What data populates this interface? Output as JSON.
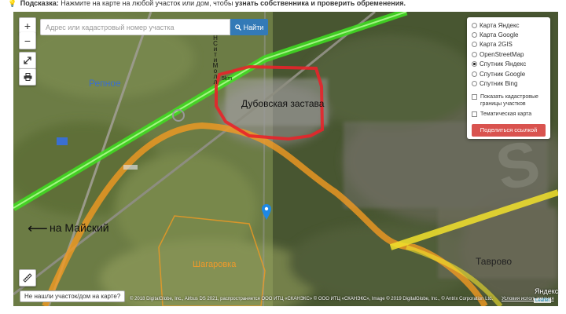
{
  "hint": {
    "icon": "lightbulb-icon",
    "prefix": "Подсказка:",
    "text": " Нажмите на карте на любой участок или дом, чтобы ",
    "emphasis": "узнать собственника и проверить обременения."
  },
  "controls": {
    "zoom_in": "+",
    "zoom_out": "−",
    "fullscreen_icon": "expand-icon",
    "print_icon": "printer-icon",
    "ruler_icon": "ruler-icon"
  },
  "search": {
    "placeholder": "Адрес или кадастровый номер участка",
    "value": "",
    "button_label": "Найти",
    "button_icon": "search-icon",
    "accent": "#337ab7"
  },
  "layers": {
    "options": [
      {
        "label": "Карта Яндекс",
        "selected": false
      },
      {
        "label": "Карта Google",
        "selected": false
      },
      {
        "label": "Карта 2GIS",
        "selected": false
      },
      {
        "label": "OpenStreetMap",
        "selected": false
      },
      {
        "label": "Спутник Яндекс",
        "selected": true
      },
      {
        "label": "Спутник Google",
        "selected": false
      },
      {
        "label": "Спутник Bing",
        "selected": false
      }
    ],
    "cadastral_label": "Показать кадастровые границы участков",
    "thematic_label": "Тематическая карта",
    "share_label": "Поделиться ссылкой",
    "share_color": "#d9534f"
  },
  "map_labels": {
    "repnoe": "Репное",
    "dubovskaya": "Дубовская застава",
    "maysky": "на Майский",
    "shagarovka": "Шагаровка",
    "tavrovo": "Таврово",
    "km": "5km",
    "vertical": "НСитиМолл"
  },
  "footer": {
    "not_found": "Не нашли участок/дом на карте?",
    "attribution": "© 2018 DigitalGlobe, Inc., Airbus DS 2021, распространяется ООО ИТЦ «СКАНЭКС» © ООО ИТЦ «СКАНЭКС», Image © 2019 DigitalGlobe, Inc., © Antrix Corporation Ltd.",
    "terms": "Условия использования",
    "yandex": "Яндекс",
    "leaflet": "Leaflet",
    "watermark": "S"
  },
  "colors": {
    "highway_green": "#39e81f",
    "road_orange": "#f39a22",
    "road_yellow": "#f2e22b",
    "zone_red": "#e8232a",
    "pin_blue": "#1e88e5"
  }
}
